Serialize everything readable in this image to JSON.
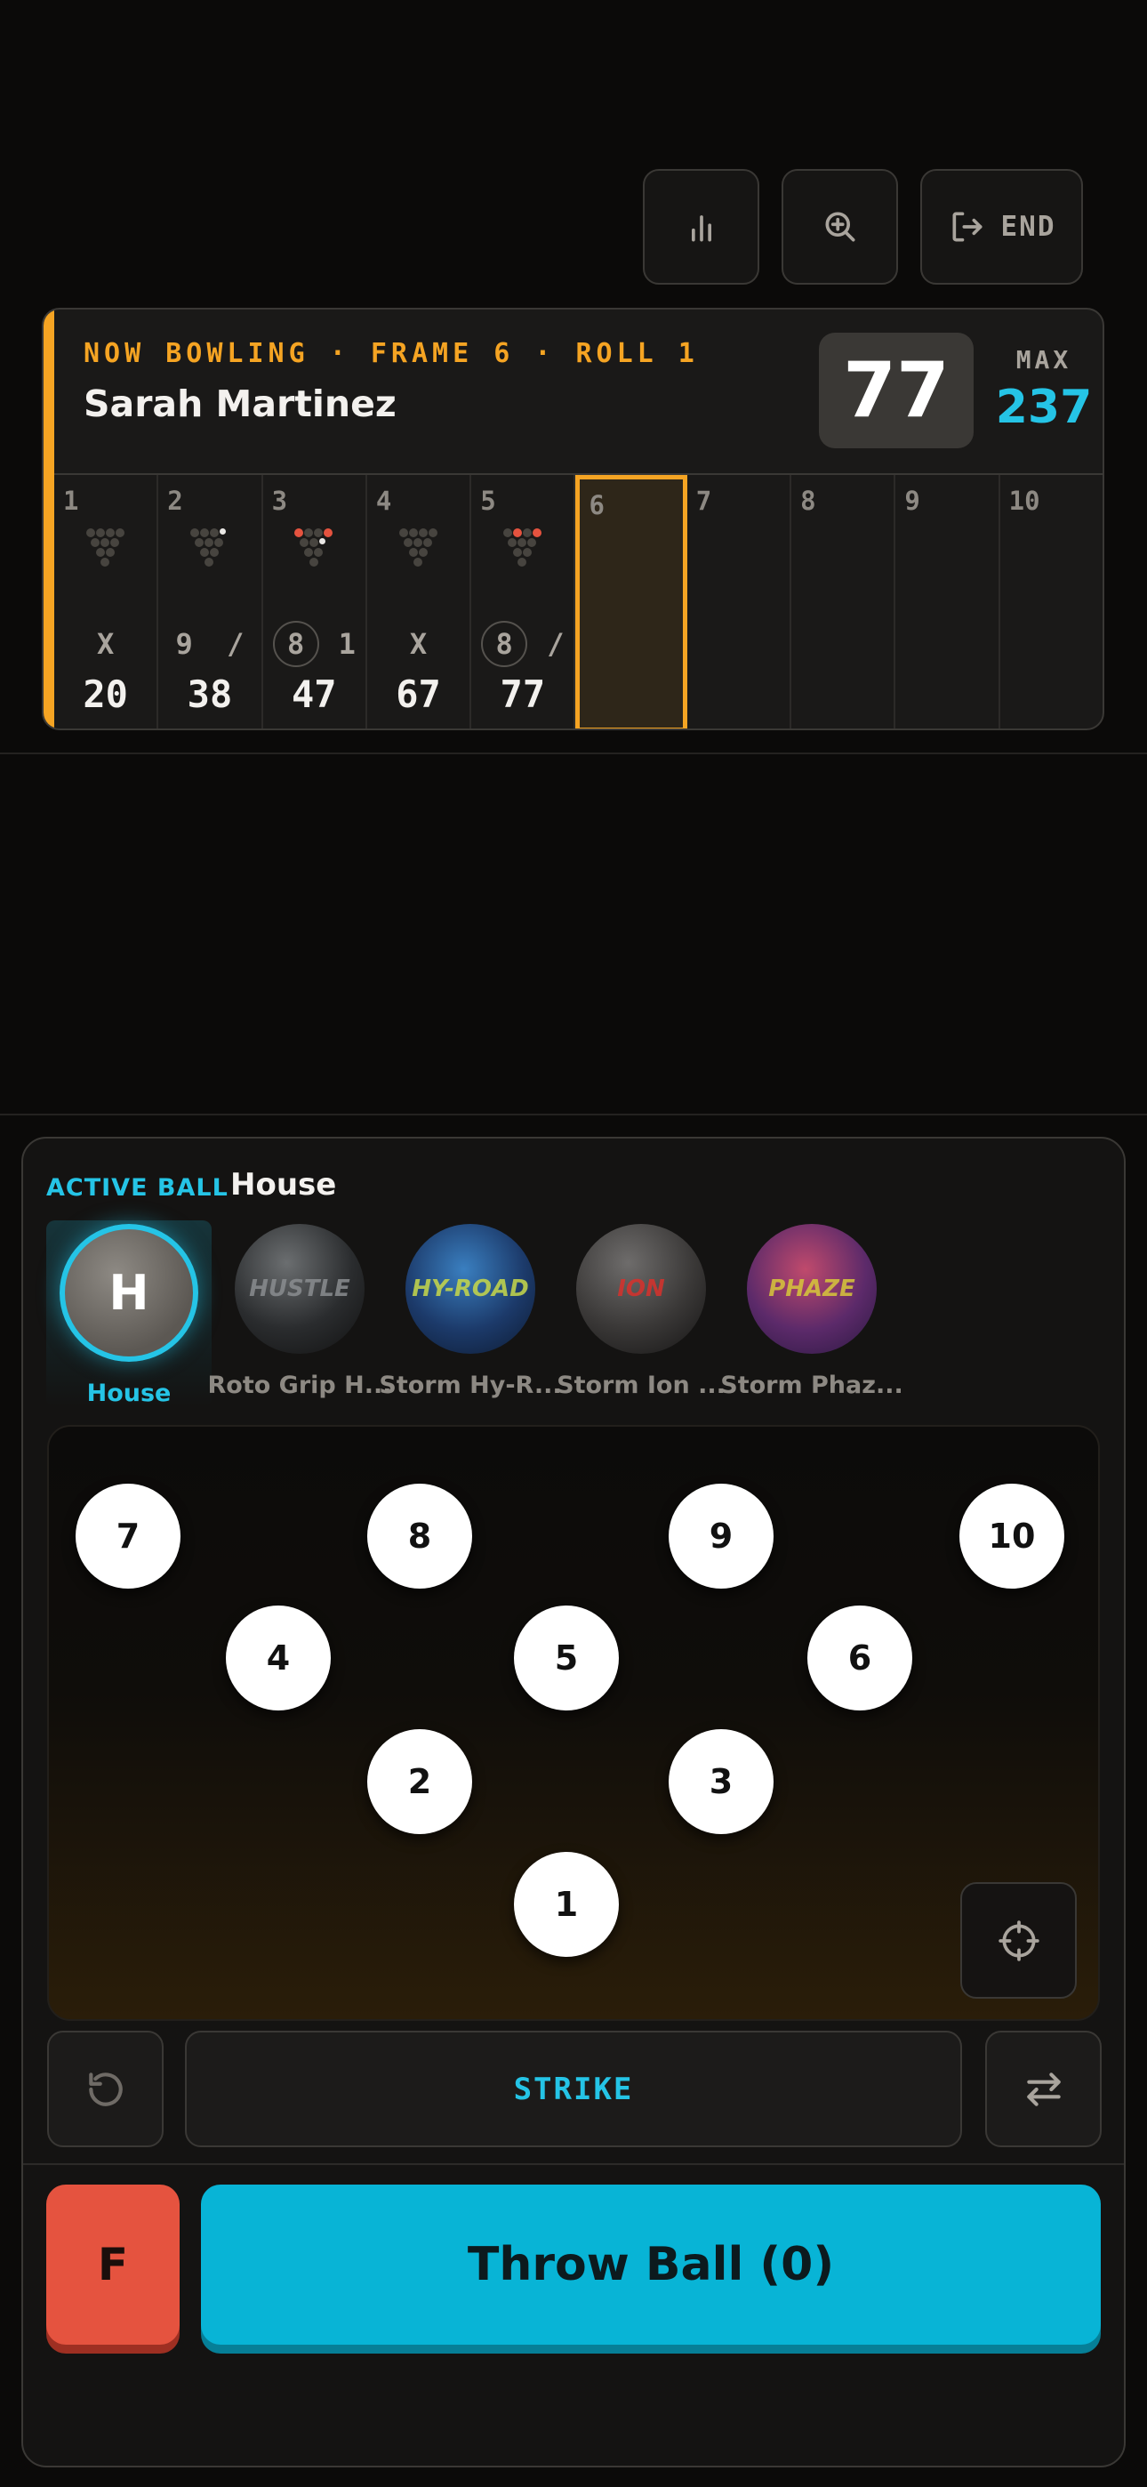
{
  "toolbar": {
    "end_label": "END"
  },
  "scorecard": {
    "status": "NOW BOWLING · FRAME 6 · ROLL 1",
    "player": "Sarah Martinez",
    "score": "77",
    "max_label": "MAX",
    "max_value": "237",
    "frames": [
      {
        "num": "1",
        "r1": "X",
        "r2": "",
        "total": "20"
      },
      {
        "num": "2",
        "r1": "9",
        "r2": "/",
        "total": "38"
      },
      {
        "num": "3",
        "r1": "8",
        "r2": "1",
        "total": "47"
      },
      {
        "num": "4",
        "r1": "X",
        "r2": "",
        "total": "67"
      },
      {
        "num": "5",
        "r1": "8",
        "r2": "/",
        "total": "77"
      },
      {
        "num": "6"
      },
      {
        "num": "7"
      },
      {
        "num": "8"
      },
      {
        "num": "9"
      },
      {
        "num": "10"
      }
    ]
  },
  "ball_panel": {
    "label": "ACTIVE BALL",
    "active": "House",
    "balls": [
      {
        "name": "House",
        "letter": "H"
      },
      {
        "name": "Roto Grip H..."
      },
      {
        "name": "Storm Hy-R..."
      },
      {
        "name": "Storm Ion ..."
      },
      {
        "name": "Storm Phaz..."
      }
    ]
  },
  "pins": [
    "1",
    "2",
    "3",
    "4",
    "5",
    "6",
    "7",
    "8",
    "9",
    "10"
  ],
  "controls": {
    "strike_label": "STRIKE",
    "foul_label": "F",
    "throw_label": "Throw Ball (0)"
  },
  "colors": {
    "accent": "#f5a423",
    "cyan": "#25c4e6",
    "foul": "#e5533f",
    "throw": "#08b4d6"
  },
  "icons": [
    "bar-chart-icon",
    "zoom-in-icon",
    "exit-icon",
    "crosshair-icon",
    "undo-icon",
    "swap-icon"
  ]
}
